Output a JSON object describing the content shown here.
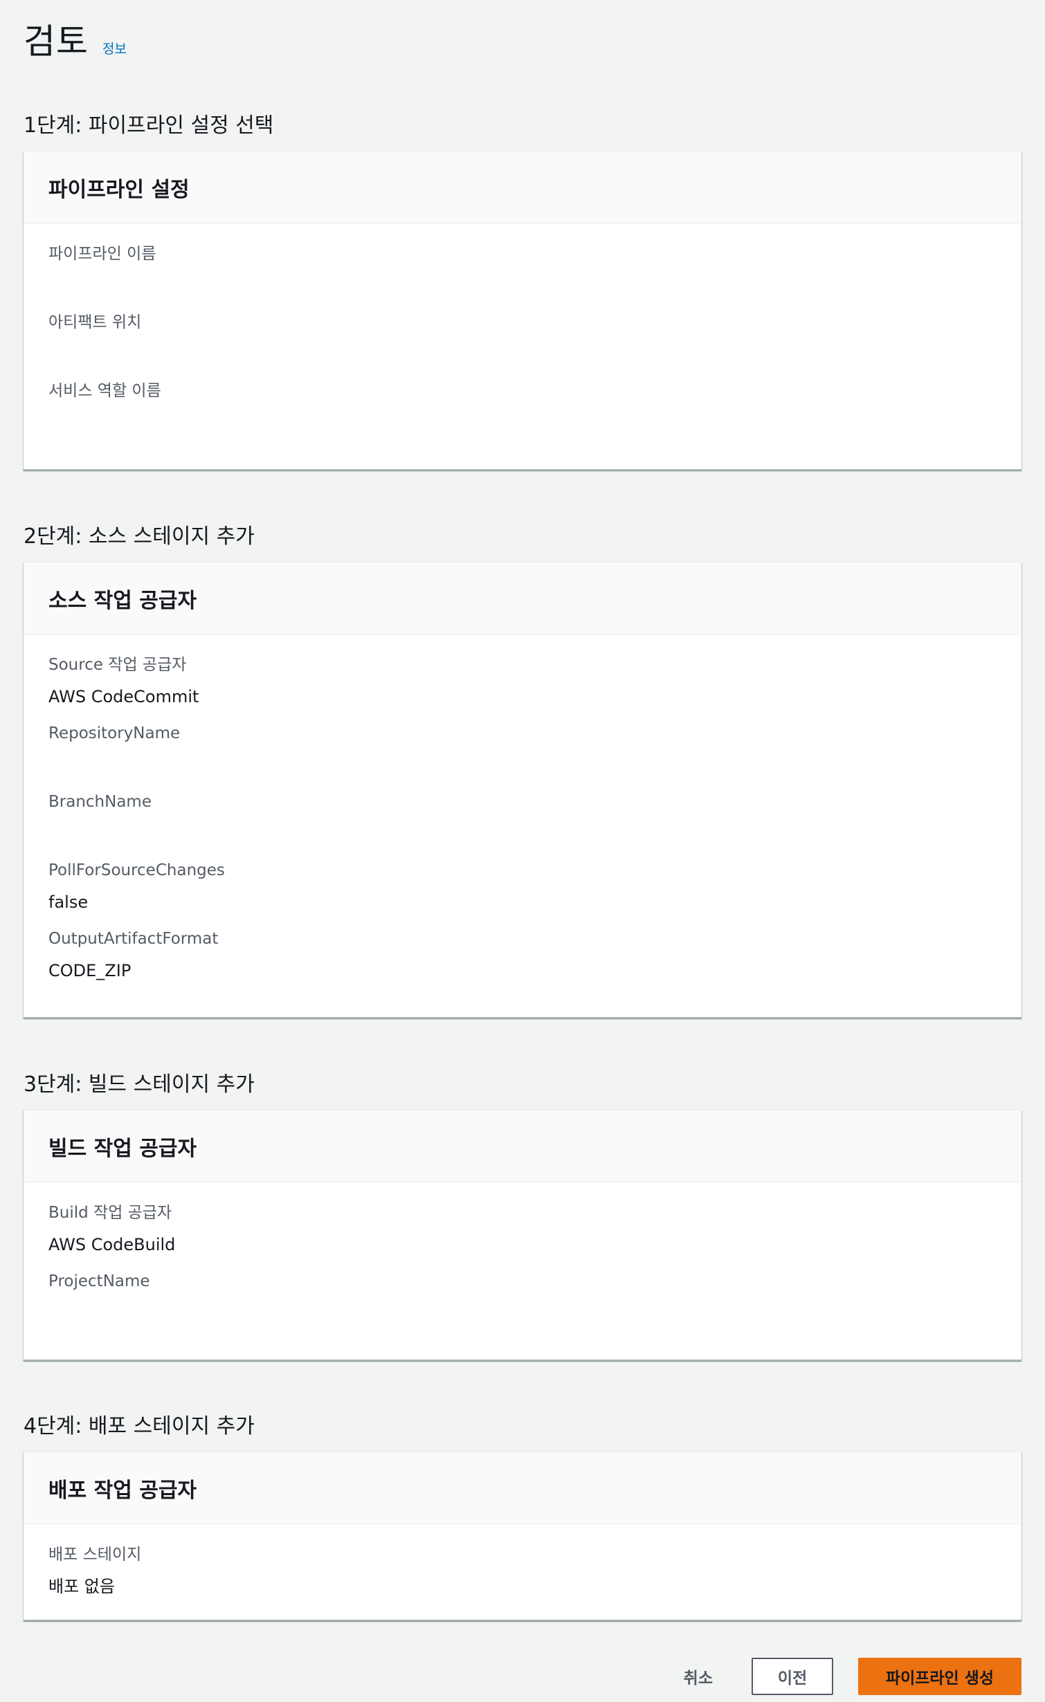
{
  "header": {
    "title": "검토",
    "info_link": "정보"
  },
  "steps": [
    {
      "title": "1단계: 파이프라인 설정 선택",
      "panel_title": "파이프라인 설정",
      "fields": [
        {
          "key": "파이프라인 이름",
          "value": ""
        },
        {
          "key": "아티팩트 위치",
          "value": ""
        },
        {
          "key": "서비스 역할 이름",
          "value": ""
        }
      ]
    },
    {
      "title": "2단계: 소스 스테이지 추가",
      "panel_title": "소스 작업 공급자",
      "fields": [
        {
          "key": "Source 작업 공급자",
          "value": "AWS CodeCommit"
        },
        {
          "key": "RepositoryName",
          "value": ""
        },
        {
          "key": "BranchName",
          "value": ""
        },
        {
          "key": "PollForSourceChanges",
          "value": "false"
        },
        {
          "key": "OutputArtifactFormat",
          "value": "CODE_ZIP"
        }
      ]
    },
    {
      "title": "3단계: 빌드 스테이지 추가",
      "panel_title": "빌드 작업 공급자",
      "fields": [
        {
          "key": "Build 작업 공급자",
          "value": "AWS CodeBuild"
        },
        {
          "key": "ProjectName",
          "value": ""
        }
      ]
    },
    {
      "title": "4단계: 배포 스테이지 추가",
      "panel_title": "배포 작업 공급자",
      "fields": [
        {
          "key": "배포 스테이지",
          "value": "배포 없음"
        }
      ]
    }
  ],
  "footer": {
    "cancel_label": "취소",
    "previous_label": "이전",
    "create_label": "파이프라인 생성"
  },
  "colors": {
    "primary_button": "#ec7211",
    "link": "#0073bb",
    "background": "#f2f3f3"
  }
}
